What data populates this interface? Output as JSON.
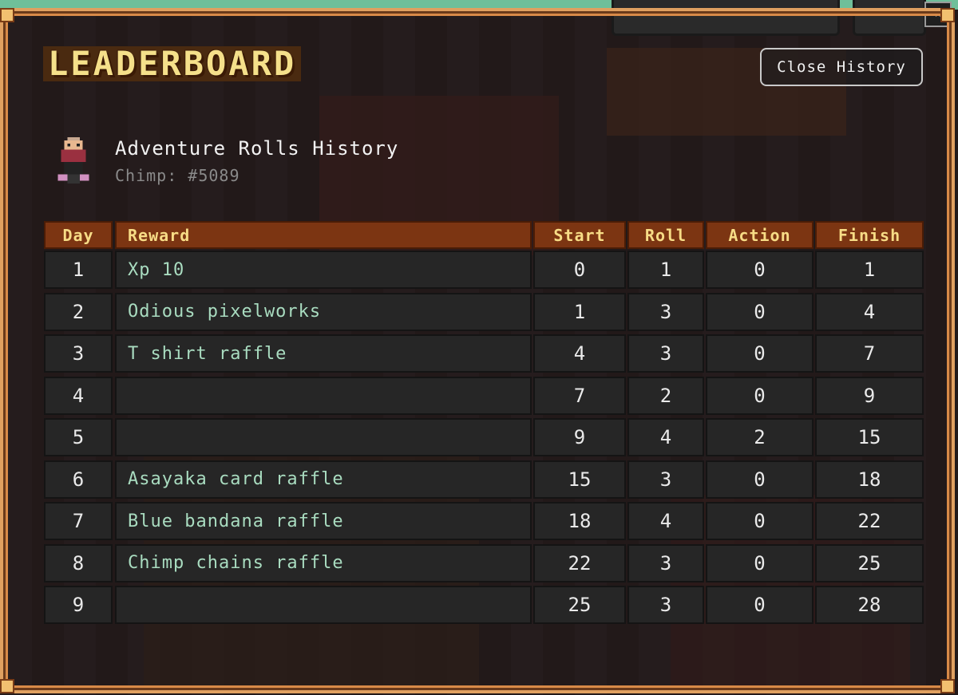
{
  "title": "LEADERBOARD",
  "close_button": "Close History",
  "close_x": "×",
  "history": {
    "title": "Adventure Rolls History",
    "chimp": "Chimp: #5089"
  },
  "table": {
    "columns": [
      "Day",
      "Reward",
      "Start",
      "Roll",
      "Action",
      "Finish"
    ],
    "rows": [
      {
        "day": "1",
        "reward": "Xp 10",
        "start": "0",
        "roll": "1",
        "action": "0",
        "finish": "1"
      },
      {
        "day": "2",
        "reward": "Odious pixelworks",
        "start": "1",
        "roll": "3",
        "action": "0",
        "finish": "4"
      },
      {
        "day": "3",
        "reward": "T shirt raffle",
        "start": "4",
        "roll": "3",
        "action": "0",
        "finish": "7"
      },
      {
        "day": "4",
        "reward": "",
        "start": "7",
        "roll": "2",
        "action": "0",
        "finish": "9"
      },
      {
        "day": "5",
        "reward": "",
        "start": "9",
        "roll": "4",
        "action": "2",
        "finish": "15"
      },
      {
        "day": "6",
        "reward": "Asayaka card raffle",
        "start": "15",
        "roll": "3",
        "action": "0",
        "finish": "18"
      },
      {
        "day": "7",
        "reward": "Blue bandana raffle",
        "start": "18",
        "roll": "4",
        "action": "0",
        "finish": "22"
      },
      {
        "day": "8",
        "reward": "Chimp chains raffle",
        "start": "22",
        "roll": "3",
        "action": "0",
        "finish": "25"
      },
      {
        "day": "9",
        "reward": "",
        "start": "25",
        "roll": "3",
        "action": "0",
        "finish": "28"
      }
    ]
  },
  "colors": {
    "header_bg": "#7c3512",
    "header_text": "#f7dc86",
    "reward_text": "#a9dcc0",
    "frame": "#e0a060"
  }
}
